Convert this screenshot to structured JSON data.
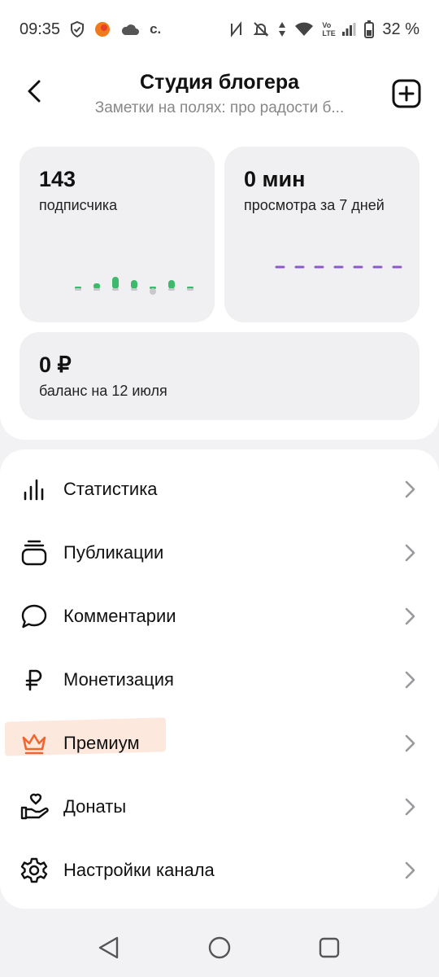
{
  "status_bar": {
    "time": "09:35",
    "icons": [
      "shield-icon",
      "notification-app-icon",
      "cloud-icon",
      "c-icon",
      "nfc-icon",
      "mute-icon",
      "data-arrows-icon",
      "wifi-icon",
      "volte-icon",
      "signal-icon",
      "battery-icon"
    ],
    "c_label": "c.",
    "volte_label": "Vo LTE",
    "battery": "32 %"
  },
  "header": {
    "title": "Студия блогера",
    "subtitle": "Заметки на полях: про радости б..."
  },
  "stats": {
    "subscribers": {
      "value": "143",
      "label": "подписчика"
    },
    "views": {
      "value": "0 мин",
      "label": "просмотра за 7 дней"
    },
    "balance": {
      "value": "0 ₽",
      "label": "баланс на 12 июля"
    }
  },
  "colors": {
    "accent_green": "#3cb96a",
    "accent_purple": "#8a5cc7",
    "premium_orange": "#f0652f",
    "premium_highlight": "#fde8de"
  },
  "menu": {
    "items": [
      {
        "label": "Статистика",
        "icon": "bar-chart-icon"
      },
      {
        "label": "Публикации",
        "icon": "stack-icon"
      },
      {
        "label": "Комментарии",
        "icon": "speech-bubble-icon"
      },
      {
        "label": "Монетизация",
        "icon": "ruble-icon"
      },
      {
        "label": "Премиум",
        "icon": "crown-icon"
      },
      {
        "label": "Донаты",
        "icon": "hand-heart-icon"
      },
      {
        "label": "Настройки канала",
        "icon": "gear-icon"
      }
    ]
  },
  "nav": {
    "buttons": [
      "back-triangle-icon",
      "home-circle-icon",
      "recents-square-icon"
    ]
  }
}
